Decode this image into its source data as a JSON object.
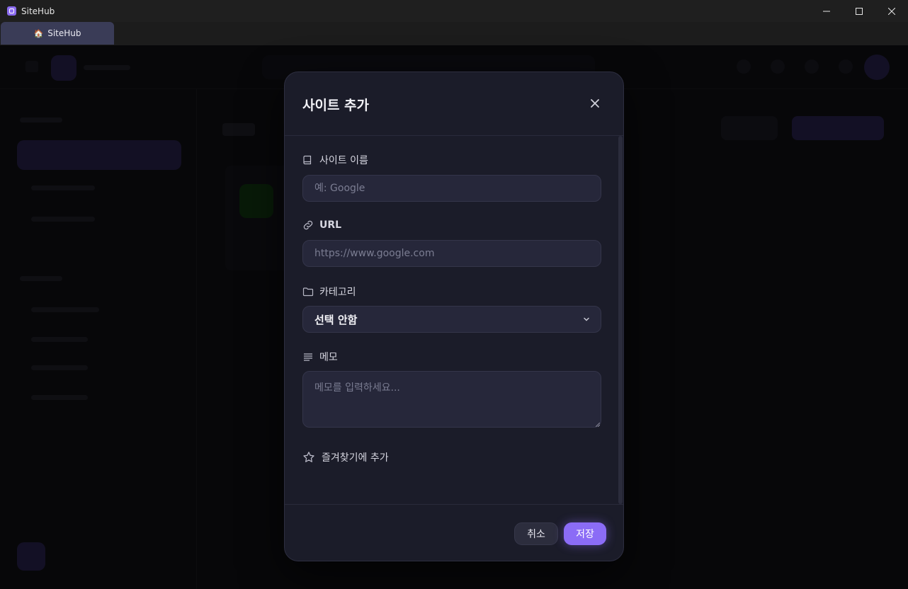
{
  "window": {
    "title": "SiteHub",
    "tab_label": "SiteHub"
  },
  "modal": {
    "title": "사이트 추가",
    "fields": {
      "name": {
        "label": "사이트 이름",
        "placeholder": "예: Google"
      },
      "url": {
        "label": "URL",
        "placeholder": "https://www.google.com"
      },
      "category": {
        "label": "카테고리",
        "selected": "선택 안함"
      },
      "memo": {
        "label": "메모",
        "placeholder": "메모를 입력하세요..."
      }
    },
    "favorite_label": "즐겨찾기에 추가",
    "buttons": {
      "cancel": "취소",
      "save": "저장"
    }
  },
  "colors": {
    "accent": "#8b6cf6",
    "modal_bg": "#1b1c29",
    "input_bg": "#26273a"
  },
  "icons": [
    "sitehub-app-icon",
    "minimize-icon",
    "maximize-icon",
    "window-close-icon",
    "close-icon",
    "book-icon",
    "link-icon",
    "folder-icon",
    "chevron-down-icon",
    "memo-lines-icon",
    "star-icon"
  ]
}
